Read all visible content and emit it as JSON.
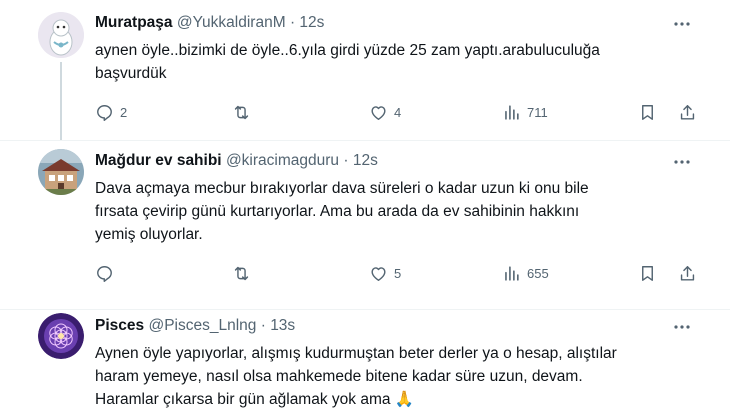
{
  "tweets": [
    {
      "name": "Muratpaşa",
      "handle": "@YukkaldiranM",
      "time": "12s",
      "lines": [
        "aynen öyle..bizimki de öyle..6.yıla girdi yüzde 25 zam yaptı.arabuluculuğa",
        "başvurdük"
      ],
      "replies": "2",
      "retweets": "",
      "likes": "4",
      "views": "711"
    },
    {
      "name": "Mağdur ev sahibi",
      "handle": "@kiracimagduru",
      "time": "12s",
      "lines": [
        "Dava açmaya mecbur bırakıyorlar dava süreleri o kadar uzun ki onu bile",
        "fırsata çevirip günü kurtarıyorlar. Ama bu arada da ev sahibinin hakkını",
        "yemiş oluyorlar."
      ],
      "replies": "",
      "retweets": "",
      "likes": "5",
      "views": "655"
    },
    {
      "name": "Pisces",
      "handle": "@Pisces_Lnlng",
      "time": "13s",
      "lines": [
        "Aynen öyle yapıyorlar, alışmış kudurmuştan beter derler ya o hesap, alıştılar",
        "haram yemeye, nasıl olsa mahkemede bitene kadar süre uzun, devam.",
        "Haramlar çıkarsa bir gün ağlamak yok ama 🙏"
      ]
    }
  ],
  "separator": "·",
  "icons": {
    "more": "more-horizontal-icon",
    "reply": "reply-icon",
    "retweet": "retweet-icon",
    "like": "heart-icon",
    "views": "views-chart-icon",
    "bookmark": "bookmark-icon",
    "share": "share-icon"
  },
  "colors": {
    "text": "#0f1419",
    "secondary": "#536471",
    "divider": "#eff3f4",
    "thread_line": "#cfd9de"
  }
}
